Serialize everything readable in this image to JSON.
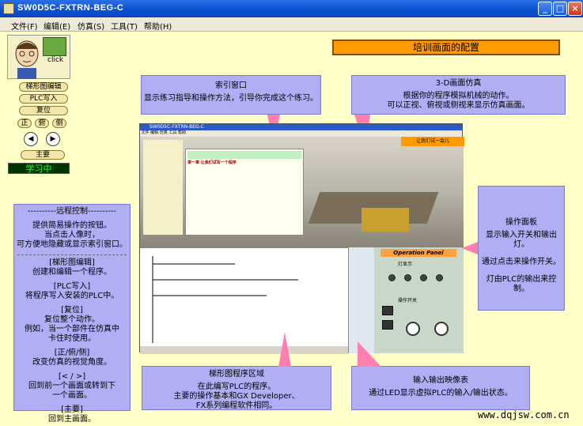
{
  "window": {
    "title": "SW0D5C-FXTRN-BEG-C"
  },
  "menu": [
    "文件(F)",
    "编辑(E)",
    "仿真(S)",
    "工具(T)",
    "帮助(H)"
  ],
  "page_title": "培训画面的配置",
  "left_panel": {
    "click_label": "click",
    "buttons": [
      "梯形图编辑",
      "PLC写入",
      "复位"
    ],
    "views": [
      "正",
      "俯",
      "侧"
    ],
    "main_label": "主要",
    "status": "学习中"
  },
  "callouts": {
    "index": {
      "title": "索引窗口",
      "text": "显示练习指导和操作方法，引导你完成这个练习。"
    },
    "sim3d": {
      "title": "3-D画面仿真",
      "lines": [
        "根据你的程序模拟机械的动作。",
        "可以正视、俯视或侧视来显示仿真画面。"
      ]
    },
    "remote": {
      "title": "----------远程控制----------",
      "lines": [
        "提供简易操作的按钮。",
        "当点击人像时，",
        "可方便地隐藏或显示索引窗口。"
      ]
    },
    "buttons_help": [
      {
        "title": "[梯形图编辑]",
        "lines": [
          "创建和编辑一个程序。"
        ]
      },
      {
        "title": "[PLC写入]",
        "lines": [
          "将程序写入安装的PLC中。"
        ]
      },
      {
        "title": "[复位]",
        "lines": [
          "复位整个动作。",
          "例如，当一个部件在仿真中",
          "卡住时使用。"
        ]
      },
      {
        "title": "[正/俯/侧]",
        "lines": [
          "改变仿真的视觉角度。"
        ]
      },
      {
        "title": "[< / >]",
        "lines": [
          "回到前一个画面或转到下",
          "一个画面。"
        ]
      },
      {
        "title": "[主要]",
        "lines": [
          "回到主画面。"
        ]
      }
    ],
    "oppanel": {
      "title": "操作面板",
      "lines": [
        "显示输入开关和输出灯。",
        "通过点击来操作开关。",
        "灯由PLC的输出来控制。"
      ]
    },
    "ladder": {
      "title": "梯形图程序区域",
      "lines": [
        "在此编写PLC的程序。",
        "主要的操作基本和GX Developer、",
        "FX系列编程软件相同。"
      ]
    },
    "io": {
      "title": "输入输出映像表",
      "text": "通过LED显示虚拟PLC的输入/输出状态。"
    }
  },
  "embedded": {
    "title": "SW0D5C-FXTRN-BEG-C",
    "lesson_chapter": "第一章  让我们试写一个程序",
    "try_label": "让我们试一会儿",
    "op_panel_title": "Operation Panel",
    "lights_label": "灯显示",
    "switch_label": "操作开关"
  },
  "watermark": "www.dqjsw.com.cn",
  "colors": {
    "bg": "#ffffc8",
    "callout": "#b0aef5",
    "accent": "#ff9a00"
  }
}
